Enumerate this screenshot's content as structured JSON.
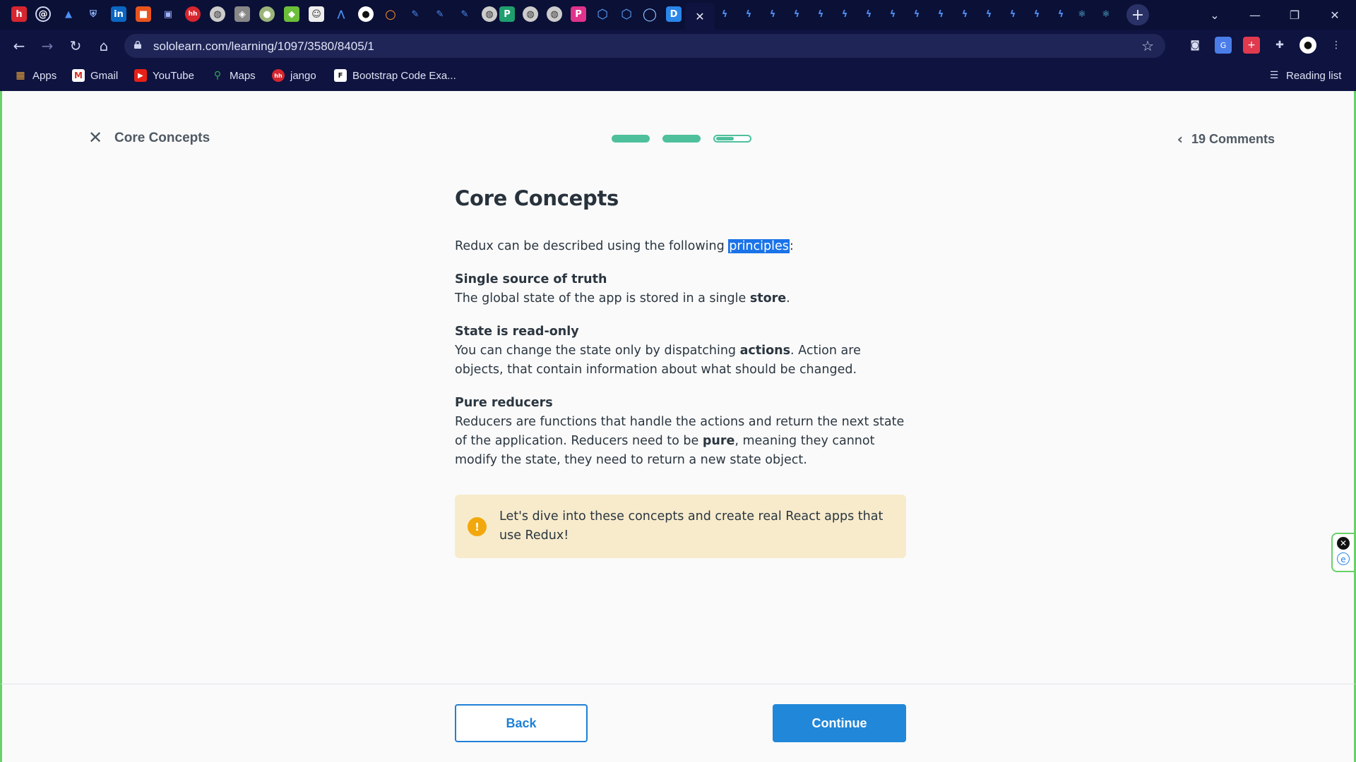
{
  "browser": {
    "active_tab_close": "✕",
    "new_tab": "+",
    "window_controls": {
      "tab_search": "⌄",
      "minimize": "—",
      "restore": "❐",
      "close": "✕"
    },
    "url": "sololearn.com/learning/1097/3580/8405/1",
    "bookmarks": [
      {
        "label": "Apps",
        "icon": "apps-grid-icon"
      },
      {
        "label": "Gmail",
        "icon": "gmail-icon"
      },
      {
        "label": "YouTube",
        "icon": "youtube-icon"
      },
      {
        "label": "Maps",
        "icon": "maps-icon"
      },
      {
        "label": "jango",
        "icon": "hh-icon"
      },
      {
        "label": "Bootstrap Code Exa...",
        "icon": "bootstrap-icon"
      }
    ],
    "reading_list": "Reading list"
  },
  "lesson": {
    "close_label": "✕",
    "header_title": "Core Concepts",
    "progress": {
      "segments_total": 3,
      "segments_completed": 2,
      "current_segment_fill": 0.55
    },
    "comments": "19 Comments",
    "title": "Core Concepts",
    "intro_before": "Redux can be described using the following ",
    "intro_highlight": "principles",
    "intro_after": ":",
    "principles": [
      {
        "heading": "Single source of truth",
        "text_before": "The global state of the app is stored in a single ",
        "bold": "store",
        "text_after": "."
      },
      {
        "heading": "State is read-only",
        "text_before": "You can change the state only by dispatching ",
        "bold": "actions",
        "text_after": ". Action are objects, that contain information about what should be changed."
      },
      {
        "heading": "Pure reducers",
        "text_before": "Reducers are functions that handle the actions and return the next state of the application. Reducers need to be ",
        "bold": "pure",
        "text_after": ", meaning they cannot modify the state, they need to return a new state object."
      }
    ],
    "note_icon": "!",
    "note": "Let's dive into these concepts and create real React apps that use Redux!",
    "back_label": "Back",
    "continue_label": "Continue"
  },
  "colors": {
    "chrome_bg": "#0e1340",
    "accent_blue": "#2187d9",
    "progress_green": "#4ec09c",
    "note_bg": "#f7ebcc",
    "note_icon": "#f2a80c"
  }
}
